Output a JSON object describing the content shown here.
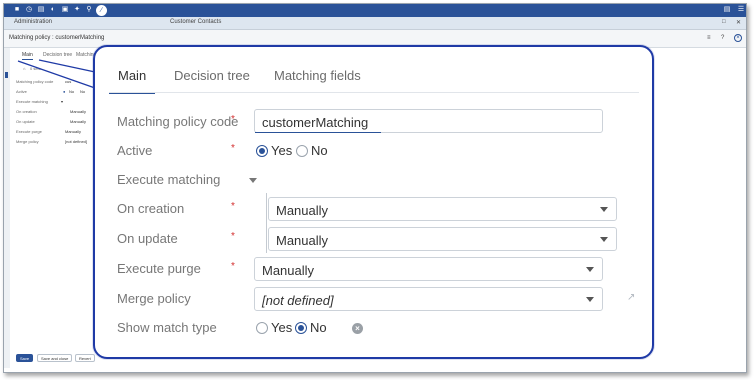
{
  "toolbar": {
    "icons": [
      "home-icon",
      "clock-icon",
      "document-icon",
      "gauge-icon",
      "database-icon",
      "wrench-icon",
      "search-icon",
      "wand-icon",
      "book-icon",
      "menu-icon"
    ]
  },
  "modulebar": {
    "left": "Administration",
    "center": "Customer Contacts"
  },
  "titlebar": {
    "title": "Matching policy : customerMatching"
  },
  "small_tabs": {
    "main": "Main",
    "decision_tree": "Decision tree",
    "matching_fields": "Matching fi"
  },
  "small_form": {
    "breadcrumb": "0 sets",
    "code_label": "Matching policy code",
    "code_value": "cus",
    "active_label": "Active",
    "active_yes": "No",
    "active_no": "No",
    "execute_matching_label": "Execute matching",
    "on_creation_label": "On creation",
    "on_creation_value": "Manually",
    "on_update_label": "On update",
    "on_update_value": "Manually",
    "execute_purge_label": "Execute purge",
    "execute_purge_value": "Manually",
    "merge_policy_label": "Merge policy",
    "merge_policy_value": "[not defined]"
  },
  "bottom_buttons": {
    "save": "Save",
    "save_close": "Save and close",
    "revert": "Revert"
  },
  "zoom": {
    "tabs": {
      "main": "Main",
      "decision_tree": "Decision tree",
      "matching_fields": "Matching fields"
    },
    "required_mark": "*",
    "fields": {
      "code_label": "Matching policy code",
      "code_value": "customerMatching",
      "active_label": "Active",
      "yes": "Yes",
      "no": "No",
      "execute_matching_label": "Execute matching",
      "on_creation_label": "On creation",
      "on_creation_value": "Manually",
      "on_update_label": "On update",
      "on_update_value": "Manually",
      "execute_purge_label": "Execute purge",
      "execute_purge_value": "Manually",
      "merge_policy_label": "Merge policy",
      "merge_policy_value": "[not defined]",
      "show_match_type_label": "Show match type"
    },
    "state": {
      "active": "Yes",
      "show_match_type": "No"
    }
  },
  "colors": {
    "brand": "#2a5298",
    "callout": "#1f3aa6",
    "required": "#d32f2f"
  }
}
